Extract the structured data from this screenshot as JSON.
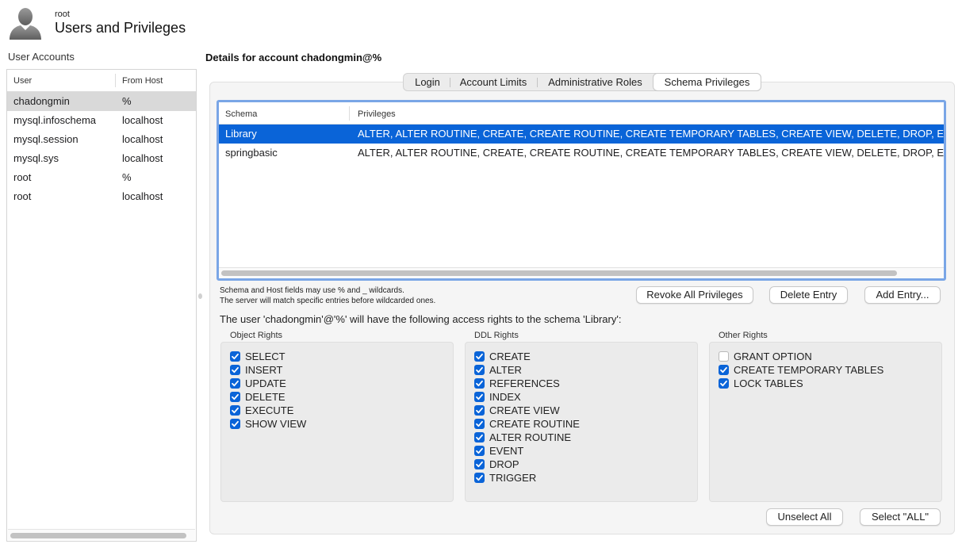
{
  "header": {
    "subtitle": "root",
    "title": "Users and Privileges"
  },
  "accounts": {
    "label": "User Accounts",
    "col_user": "User",
    "col_host": "From Host",
    "rows": [
      {
        "user": "chadongmin",
        "host": "%",
        "selected": true
      },
      {
        "user": "mysql.infoschema",
        "host": "localhost"
      },
      {
        "user": "mysql.session",
        "host": "localhost"
      },
      {
        "user": "mysql.sys",
        "host": "localhost"
      },
      {
        "user": "root",
        "host": "%"
      },
      {
        "user": "root",
        "host": "localhost"
      }
    ]
  },
  "details": {
    "title": "Details for account chadongmin@%",
    "tabs": [
      {
        "label": "Login"
      },
      {
        "label": "Account Limits"
      },
      {
        "label": "Administrative Roles"
      },
      {
        "label": "Schema Privileges",
        "active": true
      }
    ]
  },
  "schema_table": {
    "col_schema": "Schema",
    "col_privileges": "Privileges",
    "rows": [
      {
        "schema": "Library",
        "privileges": "ALTER, ALTER ROUTINE, CREATE, CREATE ROUTINE, CREATE TEMPORARY TABLES, CREATE VIEW, DELETE, DROP, EVENT",
        "selected": true
      },
      {
        "schema": "springbasic",
        "privileges": "ALTER, ALTER ROUTINE, CREATE, CREATE ROUTINE, CREATE TEMPORARY TABLES, CREATE VIEW, DELETE, DROP, EVENT"
      }
    ]
  },
  "notes": {
    "line1": "Schema and Host fields may use % and _ wildcards.",
    "line2": "The server will match specific entries before wildcarded ones."
  },
  "buttons": {
    "revoke": "Revoke All Privileges",
    "delete": "Delete Entry",
    "add": "Add Entry...",
    "unselect_all": "Unselect All",
    "select_all": "Select \"ALL\""
  },
  "access_text": "The user 'chadongmin'@'%' will have the following access rights to the schema 'Library':",
  "rights": {
    "object": {
      "label": "Object Rights",
      "items": [
        {
          "label": "SELECT",
          "checked": true
        },
        {
          "label": "INSERT",
          "checked": true
        },
        {
          "label": "UPDATE",
          "checked": true
        },
        {
          "label": "DELETE",
          "checked": true
        },
        {
          "label": "EXECUTE",
          "checked": true
        },
        {
          "label": "SHOW VIEW",
          "checked": true
        }
      ]
    },
    "ddl": {
      "label": "DDL Rights",
      "items": [
        {
          "label": "CREATE",
          "checked": true
        },
        {
          "label": "ALTER",
          "checked": true
        },
        {
          "label": "REFERENCES",
          "checked": true
        },
        {
          "label": "INDEX",
          "checked": true
        },
        {
          "label": "CREATE VIEW",
          "checked": true
        },
        {
          "label": "CREATE ROUTINE",
          "checked": true
        },
        {
          "label": "ALTER ROUTINE",
          "checked": true
        },
        {
          "label": "EVENT",
          "checked": true
        },
        {
          "label": "DROP",
          "checked": true
        },
        {
          "label": "TRIGGER",
          "checked": true
        }
      ]
    },
    "other": {
      "label": "Other Rights",
      "items": [
        {
          "label": "GRANT OPTION",
          "checked": false
        },
        {
          "label": "CREATE TEMPORARY TABLES",
          "checked": true
        },
        {
          "label": "LOCK TABLES",
          "checked": true
        }
      ]
    }
  },
  "colors": {
    "selection_blue": "#0a64d8",
    "focus_ring": "#7aa6e6",
    "row_selected_gray": "#d9d9d9"
  }
}
